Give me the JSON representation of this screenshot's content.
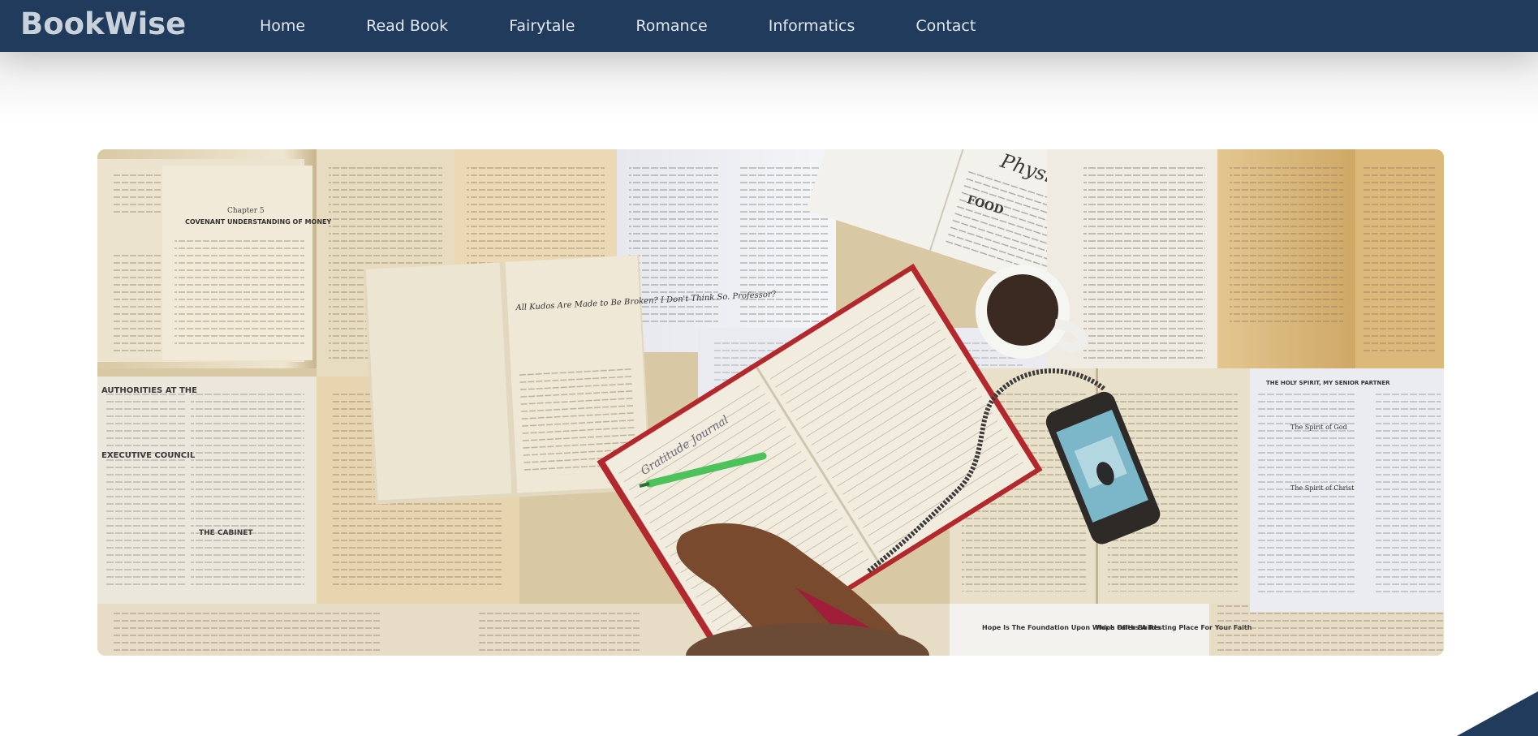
{
  "brand": {
    "name": "BookWise"
  },
  "nav": {
    "items": [
      {
        "label": "Home"
      },
      {
        "label": "Read Book"
      },
      {
        "label": "Fairytale"
      },
      {
        "label": "Romance"
      },
      {
        "label": "Informatics"
      },
      {
        "label": "Contact"
      }
    ]
  },
  "colors": {
    "navbar": "#203b5c",
    "nav_text": "#e3e8ee",
    "brand_text": "#c9d1db"
  },
  "hero": {
    "page_text": {
      "chapter": "Chapter 5",
      "covenant": "COVENANT UNDERSTANDING OF MONEY",
      "kings": "All Kudos Are Made to Be Broken? I Don't Think So. Professor?",
      "physical": "Physical Needs",
      "food": "FOOD",
      "authorities": "AUTHORITIES AT THE",
      "council": "EXECUTIVE COUNCIL",
      "cabinet": "THE CABINET",
      "holy_spirit": "THE HOLY SPIRIT, MY SENIOR PARTNER",
      "spirit_of_god": "The Spirit of God",
      "spirit_of_christ": "The Spirit of Christ",
      "hope": "Hope Is The Foundation Upon Which Faith Builds",
      "hope2": "Hope Offers A Resting Place For Your Faith",
      "notebook": "Gratitude Journal"
    }
  }
}
